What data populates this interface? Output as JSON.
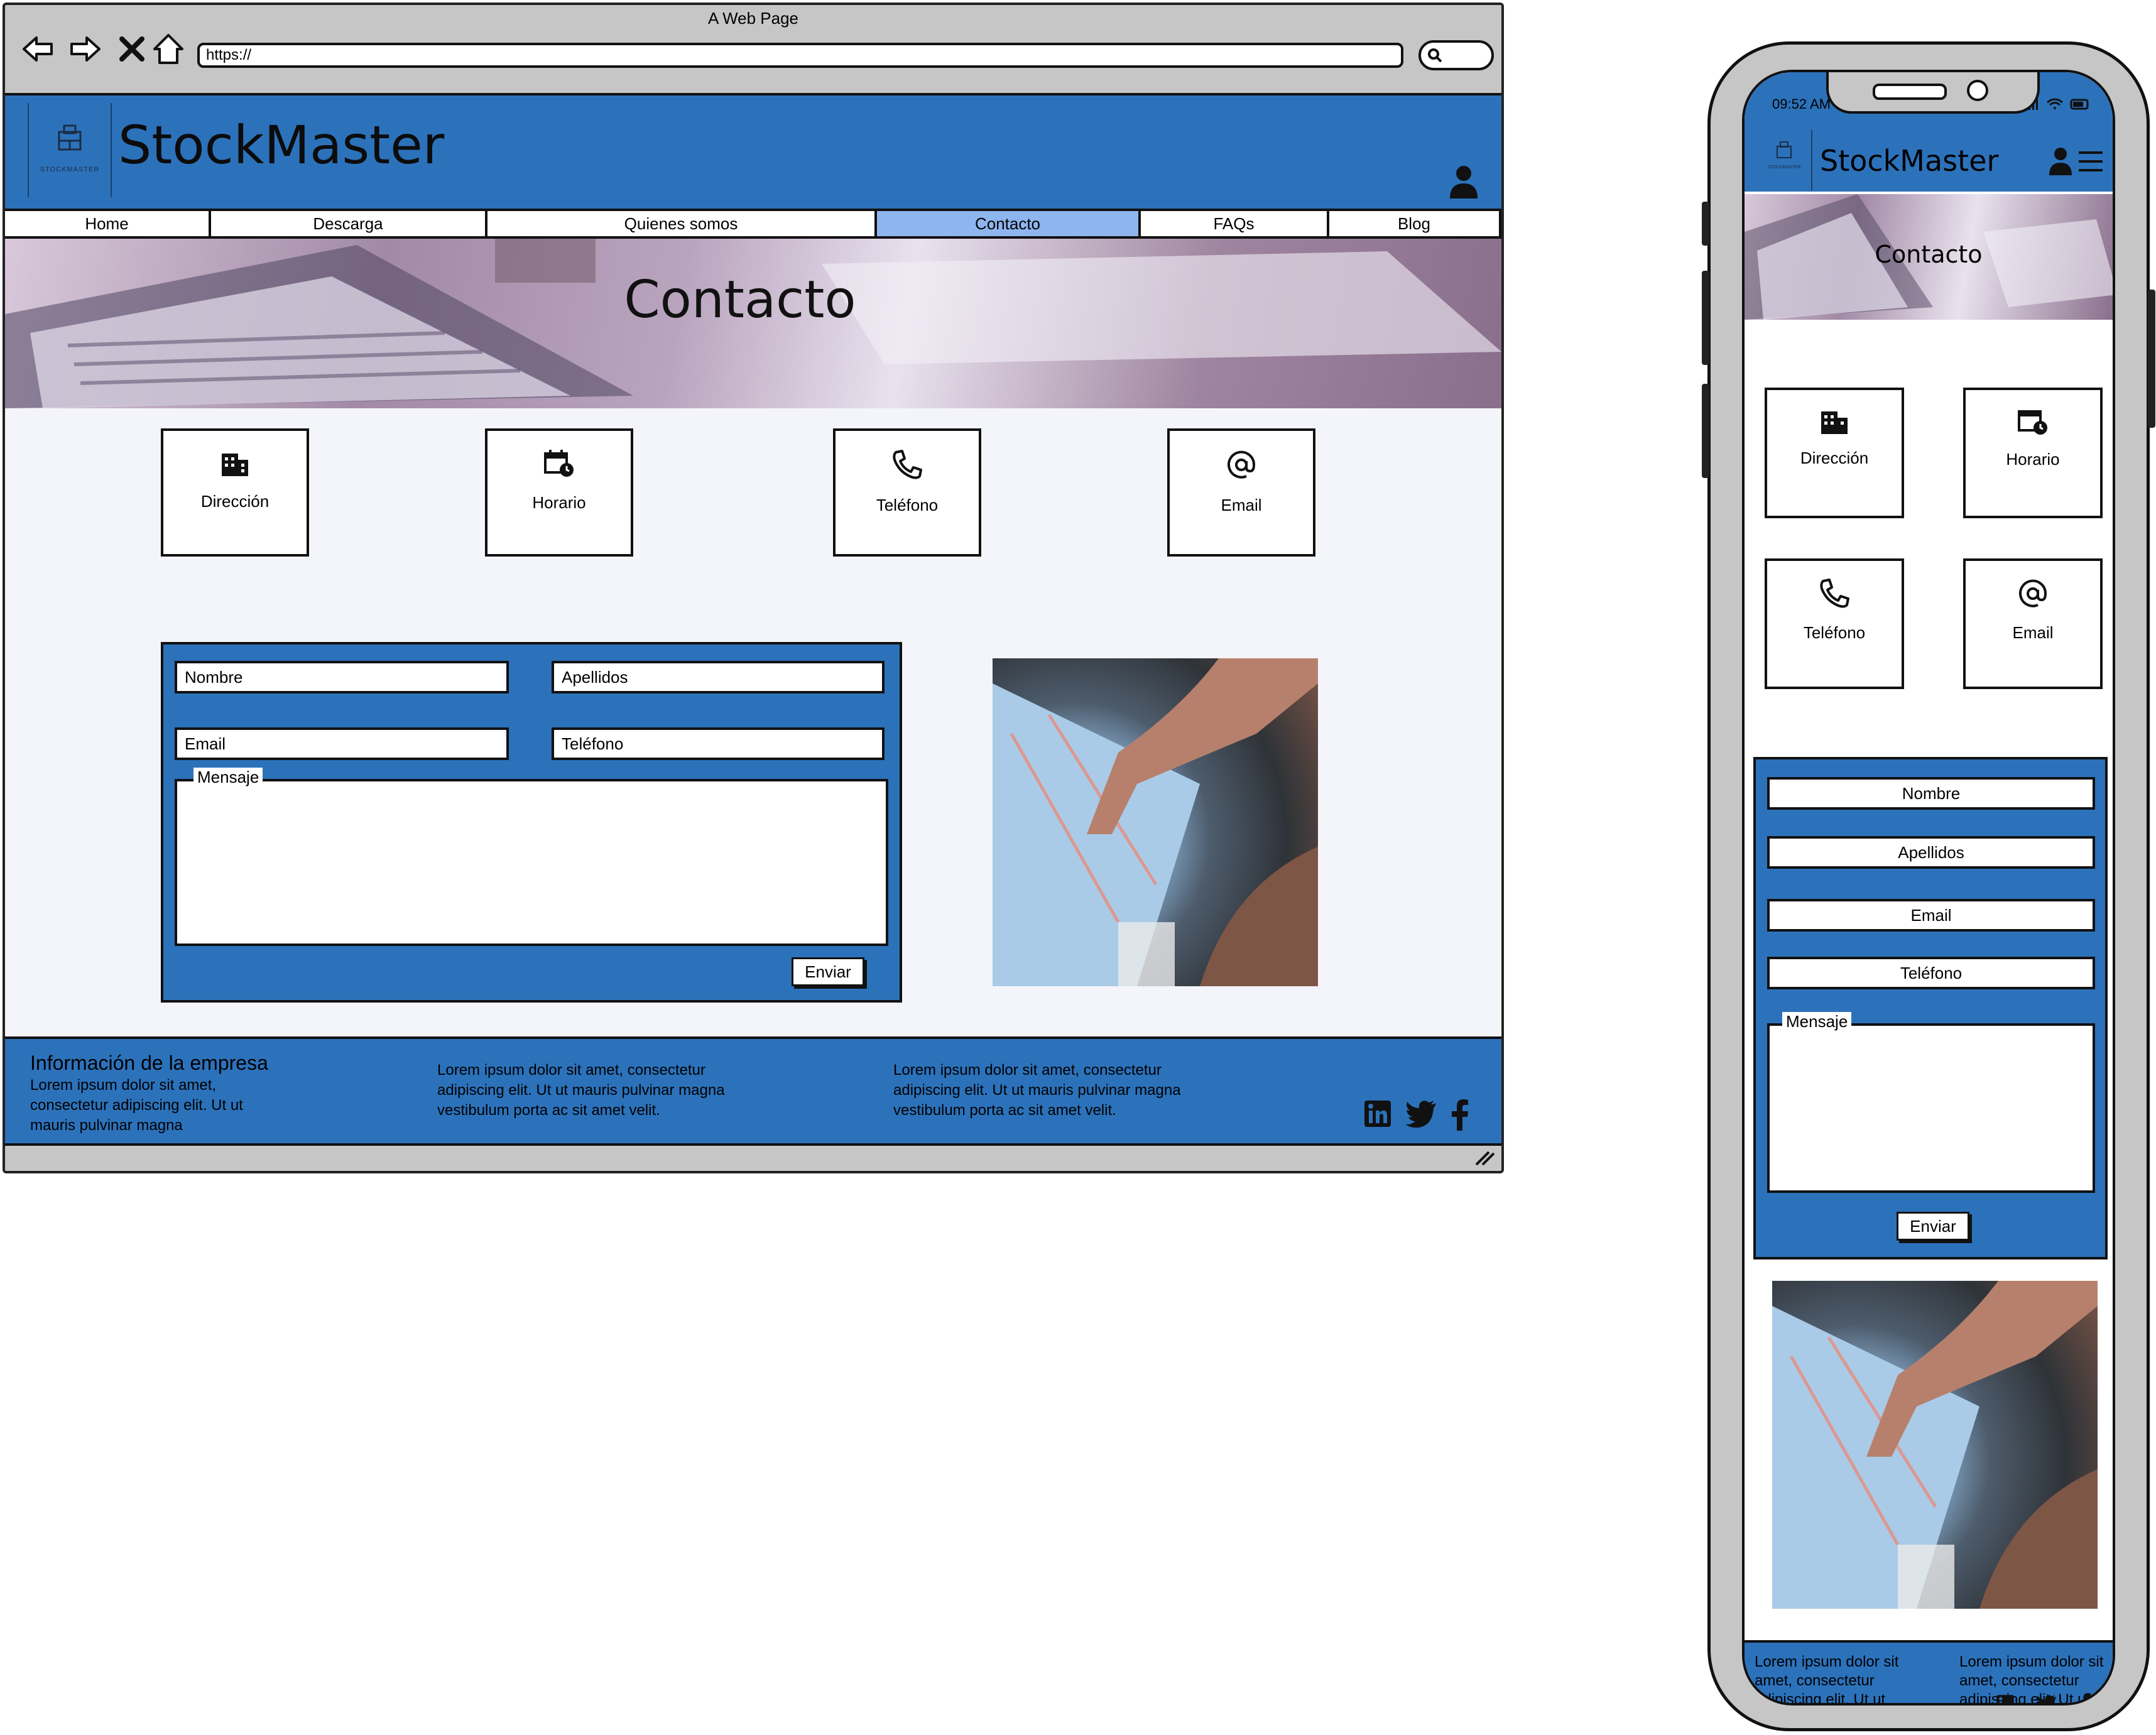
{
  "desktop": {
    "window_title": "A Web Page",
    "url": "https://",
    "site_title": "StockMaster",
    "logo_caption": "STOCKMASTER",
    "menu": [
      {
        "label": "Home",
        "active": false
      },
      {
        "label": "Descarga",
        "active": false
      },
      {
        "label": "Quienes somos",
        "active": false
      },
      {
        "label": "Contacto",
        "active": true
      },
      {
        "label": "FAQs",
        "active": false
      },
      {
        "label": "Blog",
        "active": false
      }
    ],
    "hero_title": "Contacto",
    "cards": [
      {
        "label": "Dirección",
        "icon": "building-icon"
      },
      {
        "label": "Horario",
        "icon": "calendar-clock-icon"
      },
      {
        "label": "Teléfono",
        "icon": "phone-icon"
      },
      {
        "label": "Email",
        "icon": "at-icon"
      }
    ],
    "form": {
      "nombre": "Nombre",
      "apellidos": "Apellidos",
      "email": "Email",
      "telefono": "Teléfono",
      "mensaje": "Mensaje",
      "submit": "Enviar"
    },
    "footer": {
      "heading": "Información de la empresa",
      "col1": "Lorem ipsum dolor sit amet, consectetur adipiscing elit. Ut ut mauris pulvinar magna",
      "col2": "Lorem ipsum dolor sit amet, consectetur adipiscing elit. Ut ut mauris pulvinar magna vestibulum porta ac sit amet velit.",
      "col3": "Lorem ipsum dolor sit amet, consectetur adipiscing elit. Ut ut mauris pulvinar magna vestibulum porta ac sit amet velit.",
      "social": [
        "linkedin-icon",
        "twitter-icon",
        "facebook-icon"
      ]
    }
  },
  "mobile": {
    "time": "09:52 AM",
    "site_title": "StockMaster",
    "logo_caption": "STOCKMASTER",
    "hero_title": "Contacto",
    "cards": [
      {
        "label": "Dirección",
        "icon": "building-icon"
      },
      {
        "label": "Horario",
        "icon": "calendar-clock-icon"
      },
      {
        "label": "Teléfono",
        "icon": "phone-icon"
      },
      {
        "label": "Email",
        "icon": "at-icon"
      }
    ],
    "form": {
      "nombre": "Nombre",
      "apellidos": "Apellidos",
      "email": "Email",
      "telefono": "Teléfono",
      "mensaje": "Mensaje",
      "submit": "Enviar"
    },
    "footer": {
      "col1": "Lorem ipsum dolor sit amet, consectetur adipiscing elit. Ut ut mauris pulvinar",
      "col2": "Lorem ipsum dolor sit amet, consectetur adipiscing elit. Ut ut"
    }
  },
  "colors": {
    "brand_blue": "#2c72bb",
    "active_tab": "#8fb5ef",
    "page_bg": "#f4f5fa",
    "frame_gray": "#c6c6c6"
  }
}
